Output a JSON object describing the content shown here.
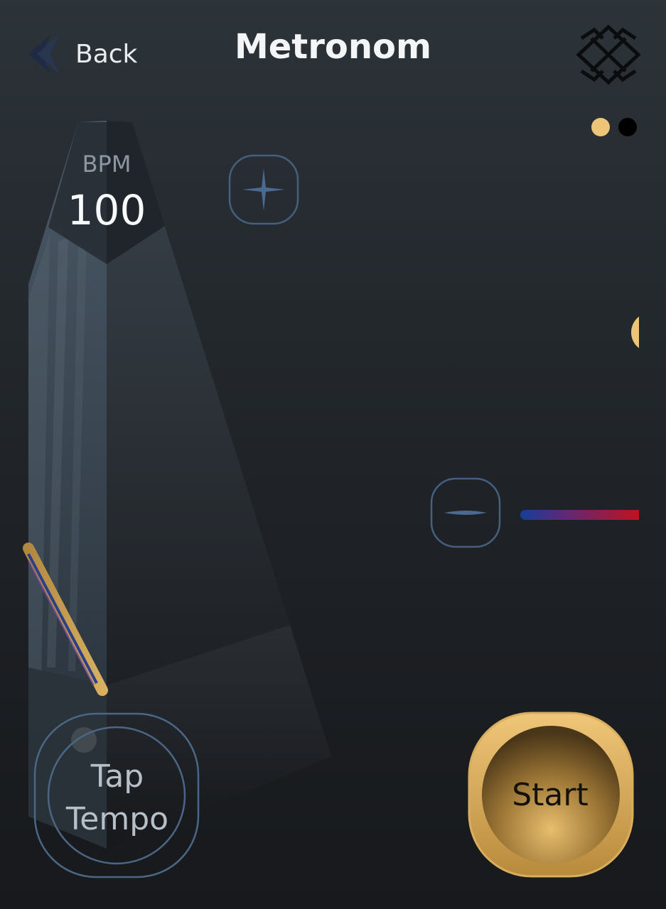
{
  "header": {
    "back_label": "Back",
    "title": "Metronom"
  },
  "metronome": {
    "bpm_label": "BPM",
    "bpm_value": "100"
  },
  "controls": {
    "tap_tempo_label": "Tap\nTempo",
    "start_label": "Start"
  },
  "pager": {
    "pages": 2,
    "active_page": 1
  },
  "colors": {
    "accent_gold": "#eec478",
    "inactive_dot": "#000000",
    "outline_blue": "#4a6685",
    "slider_start": "#143e99",
    "slider_end": "#c01220"
  },
  "icons": {
    "back": "chevron-left-icon",
    "settings": "diamond-pattern-icon",
    "increase": "plus-star-icon",
    "decrease": "minus-icon"
  }
}
